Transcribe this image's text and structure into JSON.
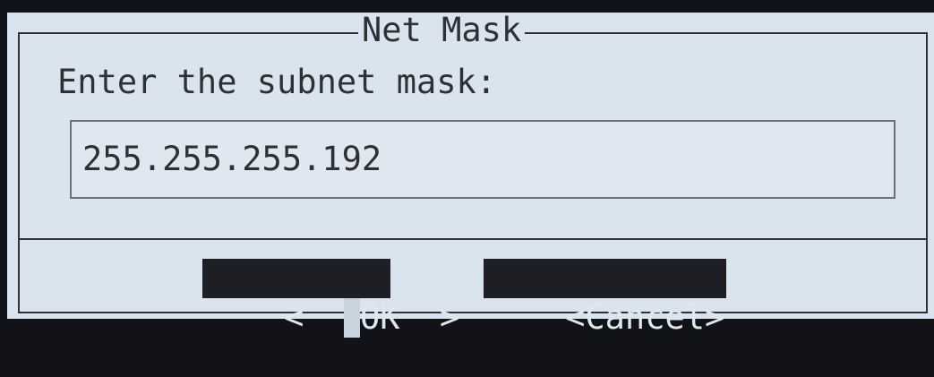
{
  "dialog": {
    "title": "Net Mask",
    "prompt": "Enter the subnet mask:",
    "input_value": "255.255.255.192",
    "ok_left": "<  ",
    "ok_label": "OK",
    "ok_right": "  >",
    "cancel_label": "<Cancel>"
  },
  "colors": {
    "background": "#d9e4ee",
    "border": "#2e3338",
    "button_bg": "#1d1f24",
    "button_text": "#dfe8f0"
  }
}
